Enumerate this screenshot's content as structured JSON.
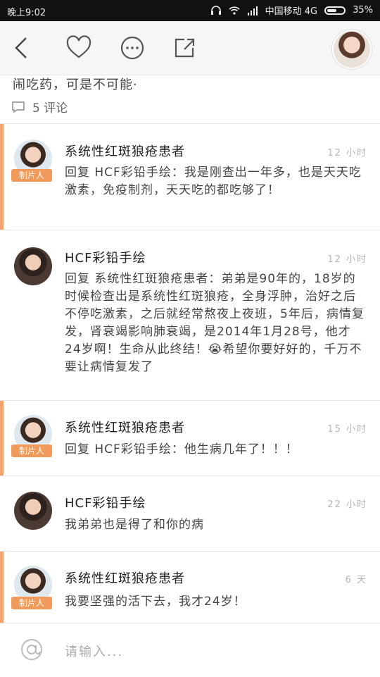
{
  "status": {
    "time": "晚上9:02",
    "carrier": "中国移动 4G",
    "battery": "35%"
  },
  "topbar": {
    "back": "back",
    "like": "like",
    "more": "more",
    "share": "share"
  },
  "snippet": {
    "text": "闹吃药，可是不可能·",
    "comment_count": "5 评论"
  },
  "comments": [
    {
      "name": "系统性红斑狼疮患者",
      "time": "12 小时",
      "badge": "制片人",
      "text": "回复 HCF彩铅手绘：我是刚查出一年多，也是天天吃激素，免疫制剂，天天吃的都吃够了！"
    },
    {
      "name": "HCF彩铅手绘",
      "time": "12 小时",
      "text": "回复 系统性红斑狼疮患者：弟弟是90年的，18岁的时候检查出是系统性红斑狼疮，全身浮肿，治好之后不停吃激素，之后就经常熬夜上夜班，5年后，病情复发，肾衰竭影响肺衰竭，是2014年1月28号，他才24岁啊！生命从此终结！😭希望你要好好的，千万不要让病情复发了"
    },
    {
      "name": "系统性红斑狼疮患者",
      "time": "15 小时",
      "badge": "制片人",
      "text": "回复 HCF彩铅手绘：他生病几年了！！！"
    },
    {
      "name": "HCF彩铅手绘",
      "time": "22 小时",
      "text": "我弟弟也是得了和你的病"
    },
    {
      "name": "系统性红斑狼疮患者",
      "time": "6 天",
      "badge": "制片人",
      "text": "我要坚强的活下去，我才24岁！"
    }
  ],
  "input": {
    "placeholder": "请输入..."
  }
}
